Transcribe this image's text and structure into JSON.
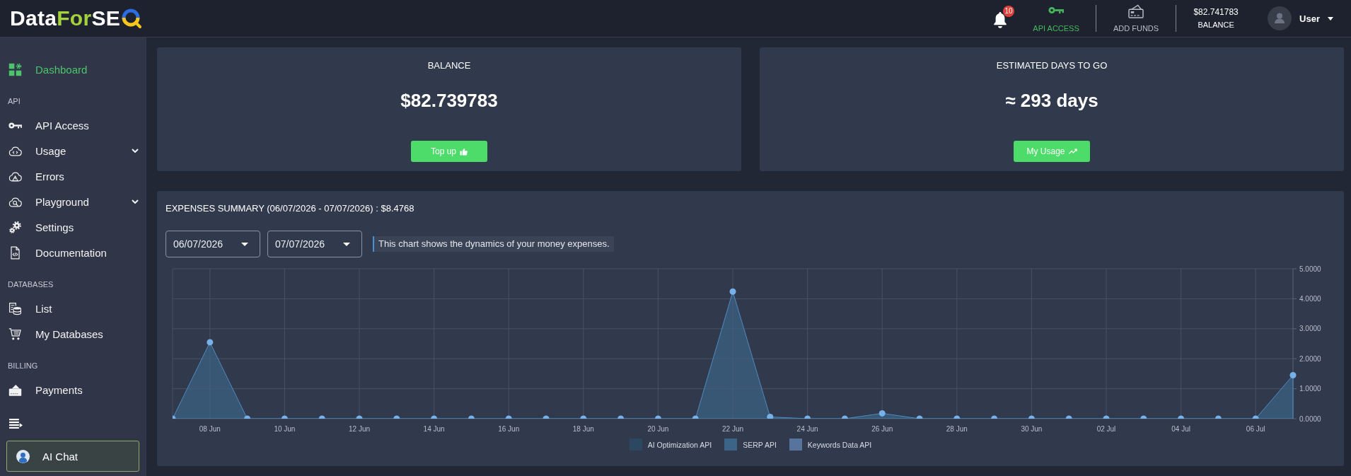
{
  "header": {
    "logo": [
      "Data",
      "For",
      "SE"
    ],
    "notifications": {
      "count": "10"
    },
    "nav": [
      {
        "label": "API ACCESS",
        "color": "#46b85e"
      },
      {
        "label": "ADD FUNDS",
        "color": "#b9bdc6"
      }
    ],
    "balance": {
      "amount": "$82.741783",
      "label": "BALANCE"
    },
    "user": {
      "name": "User"
    }
  },
  "sidebar": {
    "sections": [
      {
        "items": [
          {
            "label": "Dashboard",
            "selected": true
          }
        ]
      },
      {
        "title": "API",
        "items": [
          {
            "label": "API Access",
            "selected": false
          },
          {
            "label": "Usage",
            "selected": false,
            "expanded": false
          },
          {
            "label": "Errors",
            "selected": false
          },
          {
            "label": "Playground",
            "selected": false,
            "expanded": false
          },
          {
            "label": "Settings",
            "selected": false
          },
          {
            "label": "Documentation",
            "selected": false
          }
        ]
      },
      {
        "title": "DATABASES",
        "items": [
          {
            "label": "List",
            "selected": false
          },
          {
            "label": "My Databases",
            "selected": false
          }
        ]
      },
      {
        "title": "BILLING",
        "items": [
          {
            "label": "Payments",
            "selected": false
          }
        ]
      }
    ],
    "ai_chat": {
      "label": "AI Chat"
    }
  },
  "summary_cards": [
    {
      "title": "BALANCE",
      "value": "$82.739783",
      "button": "Top up"
    },
    {
      "title": "ESTIMATED DAYS TO GO",
      "value": "≈ 293 days",
      "button": "My Usage"
    }
  ],
  "expenses": {
    "title": "EXPENSES SUMMARY (06/07/2026 - 07/07/2026) : $8.4768",
    "date_from": "06/07/2026",
    "date_to": "07/07/2026",
    "hint": "This chart shows the dynamics of your money expenses.",
    "chart_data": {
      "type": "area",
      "grid": true,
      "categories": [
        null,
        "08 Jun",
        null,
        "10 Jun",
        null,
        "12 Jun",
        null,
        "14 Jun",
        null,
        "16 Jun",
        null,
        "18 Jun",
        null,
        "20 Jun",
        null,
        "22 Jun",
        null,
        "24 Jun",
        null,
        "26 Jun",
        null,
        "28 Jun",
        null,
        "30 Jun",
        null,
        "02 Jul",
        null,
        "04 Jul",
        null,
        "06 Jul",
        null
      ],
      "ylim": [
        0,
        5
      ],
      "yticks": [
        {
          "value": 0,
          "label": "0.0000"
        },
        {
          "value": 1,
          "label": "1.0000"
        },
        {
          "value": 2,
          "label": "2.0000"
        },
        {
          "value": 3,
          "label": "3.0000"
        },
        {
          "value": 4,
          "label": "4.0000"
        },
        {
          "value": 5,
          "label": "5.0000"
        }
      ],
      "series": [
        {
          "name": "AI Optimization API",
          "color": "#2c4760",
          "values": [
            null,
            null,
            null,
            null,
            null,
            null,
            null,
            null,
            null,
            null,
            null,
            null,
            null,
            null,
            null,
            null,
            null,
            null,
            null,
            null,
            null,
            null,
            null,
            null,
            null,
            null,
            null,
            null,
            null,
            null,
            null
          ]
        },
        {
          "name": "SERP API",
          "color": "#3c6486",
          "values": [
            0,
            2.55,
            0,
            0,
            0,
            0,
            0,
            0,
            0,
            0,
            0,
            0,
            0,
            0,
            0,
            4.24,
            0.06,
            0,
            0,
            0.18,
            0,
            0,
            0,
            0,
            0,
            0,
            0,
            0,
            0,
            0,
            1.45
          ]
        },
        {
          "name": "Keywords Data API",
          "color": "#57759c",
          "values": [
            null,
            null,
            null,
            null,
            null,
            null,
            null,
            null,
            null,
            null,
            null,
            null,
            null,
            null,
            null,
            null,
            null,
            null,
            null,
            null,
            null,
            null,
            null,
            null,
            null,
            null,
            null,
            null,
            null,
            null,
            null
          ]
        }
      ]
    }
  }
}
